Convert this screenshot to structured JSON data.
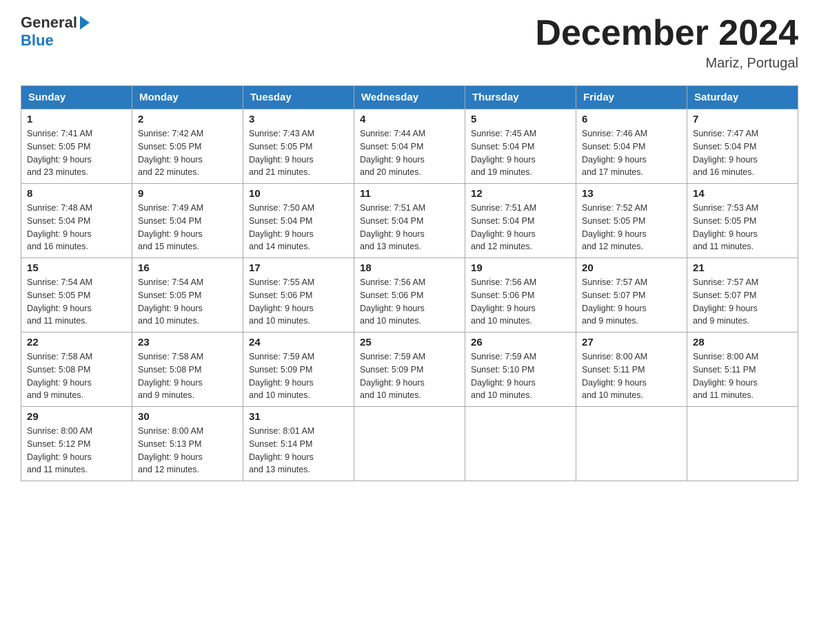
{
  "logo": {
    "general": "General",
    "blue": "Blue"
  },
  "header": {
    "title": "December 2024",
    "location": "Mariz, Portugal"
  },
  "days_of_week": [
    "Sunday",
    "Monday",
    "Tuesday",
    "Wednesday",
    "Thursday",
    "Friday",
    "Saturday"
  ],
  "weeks": [
    [
      {
        "day": "1",
        "sunrise": "7:41 AM",
        "sunset": "5:05 PM",
        "daylight": "9 hours and 23 minutes."
      },
      {
        "day": "2",
        "sunrise": "7:42 AM",
        "sunset": "5:05 PM",
        "daylight": "9 hours and 22 minutes."
      },
      {
        "day": "3",
        "sunrise": "7:43 AM",
        "sunset": "5:05 PM",
        "daylight": "9 hours and 21 minutes."
      },
      {
        "day": "4",
        "sunrise": "7:44 AM",
        "sunset": "5:04 PM",
        "daylight": "9 hours and 20 minutes."
      },
      {
        "day": "5",
        "sunrise": "7:45 AM",
        "sunset": "5:04 PM",
        "daylight": "9 hours and 19 minutes."
      },
      {
        "day": "6",
        "sunrise": "7:46 AM",
        "sunset": "5:04 PM",
        "daylight": "9 hours and 17 minutes."
      },
      {
        "day": "7",
        "sunrise": "7:47 AM",
        "sunset": "5:04 PM",
        "daylight": "9 hours and 16 minutes."
      }
    ],
    [
      {
        "day": "8",
        "sunrise": "7:48 AM",
        "sunset": "5:04 PM",
        "daylight": "9 hours and 16 minutes."
      },
      {
        "day": "9",
        "sunrise": "7:49 AM",
        "sunset": "5:04 PM",
        "daylight": "9 hours and 15 minutes."
      },
      {
        "day": "10",
        "sunrise": "7:50 AM",
        "sunset": "5:04 PM",
        "daylight": "9 hours and 14 minutes."
      },
      {
        "day": "11",
        "sunrise": "7:51 AM",
        "sunset": "5:04 PM",
        "daylight": "9 hours and 13 minutes."
      },
      {
        "day": "12",
        "sunrise": "7:51 AM",
        "sunset": "5:04 PM",
        "daylight": "9 hours and 12 minutes."
      },
      {
        "day": "13",
        "sunrise": "7:52 AM",
        "sunset": "5:05 PM",
        "daylight": "9 hours and 12 minutes."
      },
      {
        "day": "14",
        "sunrise": "7:53 AM",
        "sunset": "5:05 PM",
        "daylight": "9 hours and 11 minutes."
      }
    ],
    [
      {
        "day": "15",
        "sunrise": "7:54 AM",
        "sunset": "5:05 PM",
        "daylight": "9 hours and 11 minutes."
      },
      {
        "day": "16",
        "sunrise": "7:54 AM",
        "sunset": "5:05 PM",
        "daylight": "9 hours and 10 minutes."
      },
      {
        "day": "17",
        "sunrise": "7:55 AM",
        "sunset": "5:06 PM",
        "daylight": "9 hours and 10 minutes."
      },
      {
        "day": "18",
        "sunrise": "7:56 AM",
        "sunset": "5:06 PM",
        "daylight": "9 hours and 10 minutes."
      },
      {
        "day": "19",
        "sunrise": "7:56 AM",
        "sunset": "5:06 PM",
        "daylight": "9 hours and 10 minutes."
      },
      {
        "day": "20",
        "sunrise": "7:57 AM",
        "sunset": "5:07 PM",
        "daylight": "9 hours and 9 minutes."
      },
      {
        "day": "21",
        "sunrise": "7:57 AM",
        "sunset": "5:07 PM",
        "daylight": "9 hours and 9 minutes."
      }
    ],
    [
      {
        "day": "22",
        "sunrise": "7:58 AM",
        "sunset": "5:08 PM",
        "daylight": "9 hours and 9 minutes."
      },
      {
        "day": "23",
        "sunrise": "7:58 AM",
        "sunset": "5:08 PM",
        "daylight": "9 hours and 9 minutes."
      },
      {
        "day": "24",
        "sunrise": "7:59 AM",
        "sunset": "5:09 PM",
        "daylight": "9 hours and 10 minutes."
      },
      {
        "day": "25",
        "sunrise": "7:59 AM",
        "sunset": "5:09 PM",
        "daylight": "9 hours and 10 minutes."
      },
      {
        "day": "26",
        "sunrise": "7:59 AM",
        "sunset": "5:10 PM",
        "daylight": "9 hours and 10 minutes."
      },
      {
        "day": "27",
        "sunrise": "8:00 AM",
        "sunset": "5:11 PM",
        "daylight": "9 hours and 10 minutes."
      },
      {
        "day": "28",
        "sunrise": "8:00 AM",
        "sunset": "5:11 PM",
        "daylight": "9 hours and 11 minutes."
      }
    ],
    [
      {
        "day": "29",
        "sunrise": "8:00 AM",
        "sunset": "5:12 PM",
        "daylight": "9 hours and 11 minutes."
      },
      {
        "day": "30",
        "sunrise": "8:00 AM",
        "sunset": "5:13 PM",
        "daylight": "9 hours and 12 minutes."
      },
      {
        "day": "31",
        "sunrise": "8:01 AM",
        "sunset": "5:14 PM",
        "daylight": "9 hours and 13 minutes."
      },
      null,
      null,
      null,
      null
    ]
  ],
  "labels": {
    "sunrise": "Sunrise:",
    "sunset": "Sunset:",
    "daylight": "Daylight:"
  }
}
